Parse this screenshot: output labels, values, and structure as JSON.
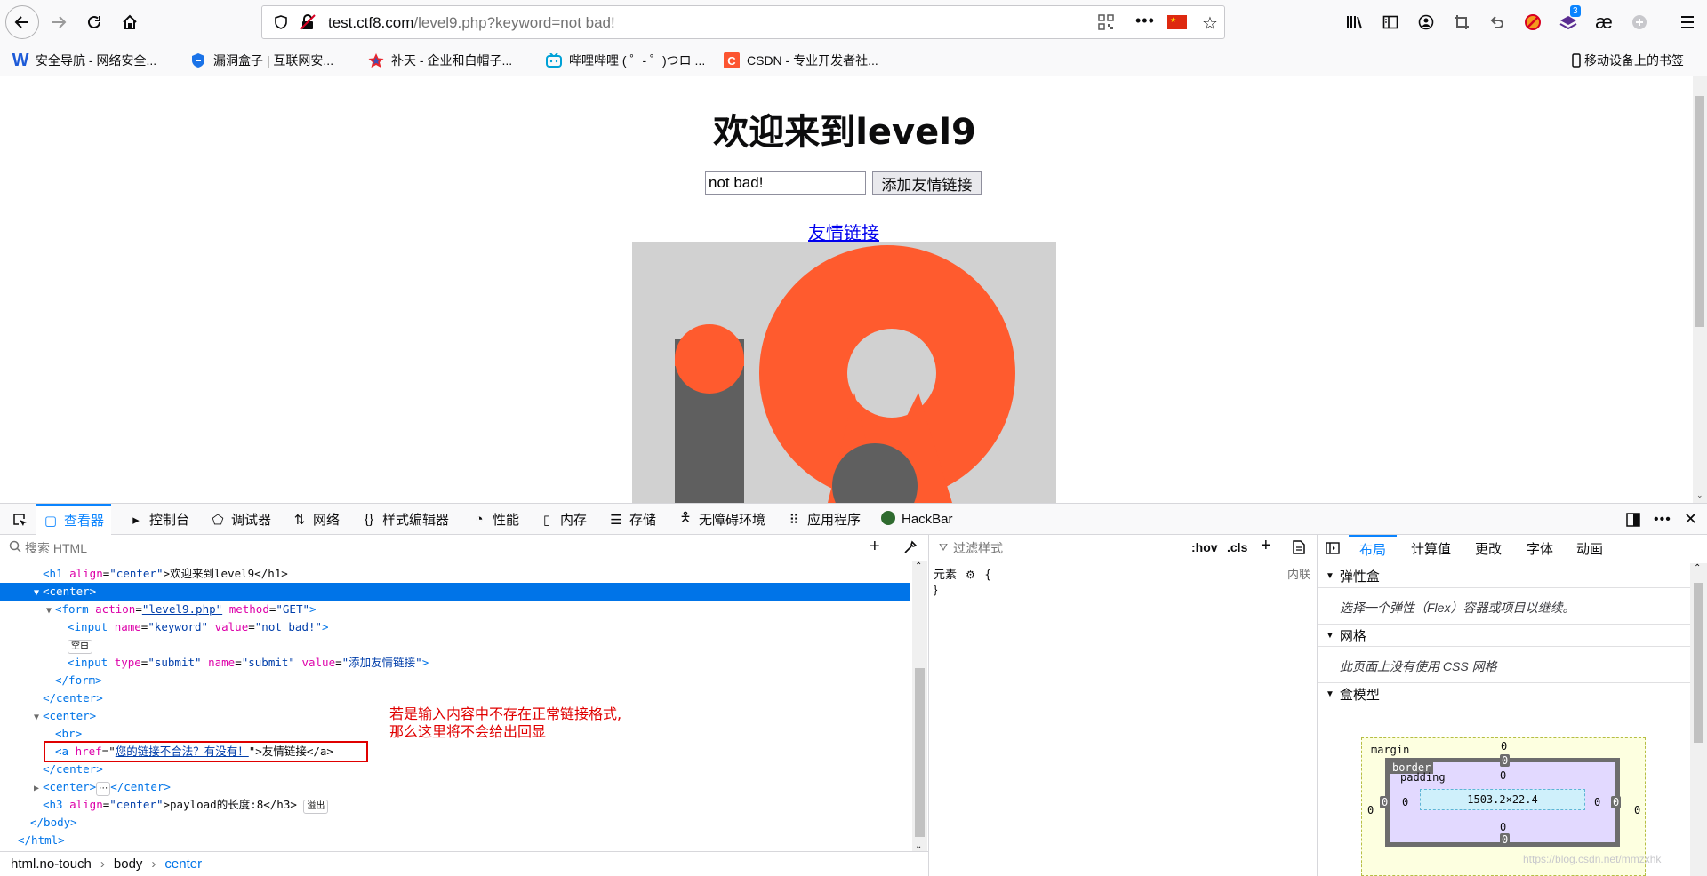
{
  "browser": {
    "url_host": "test.ctf8.com",
    "url_path": "/level9.php?keyword=not bad!",
    "ext_badge": "3",
    "ext_ae": "æ"
  },
  "bookmarks": [
    {
      "icon": "W",
      "label": "安全导航 - 网络安全..."
    },
    {
      "icon": "shield",
      "label": "漏洞盒子 | 互联网安..."
    },
    {
      "icon": "star",
      "label": "补天 - 企业和白帽子..."
    },
    {
      "icon": "tv",
      "label": "哔哩哔哩 ( ゜- ゜)つロ ..."
    },
    {
      "icon": "C",
      "label": "CSDN - 专业开发者社..."
    }
  ],
  "mobile_bookmarks": "移动设备上的书签",
  "page": {
    "heading": "欢迎来到level9",
    "keyword_value": "not bad!",
    "submit_label": "添加友情链接",
    "link_text": "友情链接"
  },
  "devtools": {
    "tabs": [
      "查看器",
      "控制台",
      "调试器",
      "网络",
      "样式编辑器",
      "性能",
      "内存",
      "存储",
      "无障碍环境",
      "应用程序",
      "HackBar"
    ],
    "search_placeholder": "搜索 HTML",
    "code": {
      "l1_open": "<h1 ",
      "l1_attr": "align",
      "l1_val": "\"center\"",
      "l1_rest": ">欢迎来到level9</h1>",
      "l2": "<center>",
      "l3_form": "<form ",
      "l3_a1": "action",
      "l3_v1": "\"level9.php\"",
      "l3_a2": "method",
      "l3_v2": "\"GET\"",
      "l4_input": "<input ",
      "l4_a1": "name",
      "l4_v1": "\"keyword\"",
      "l4_a2": "value",
      "l4_v2": "\"not bad!\"",
      "badge_blank": "空白",
      "l6_a1": "type",
      "l6_v1": "\"submit\"",
      "l6_a2": "name",
      "l6_v2": "\"submit\"",
      "l6_a3": "value",
      "l6_v3": "\"添加友情链接\"",
      "l7": "</form>",
      "l8": "</center>",
      "l9": "<center>",
      "l10": "<br>",
      "l11_open": "<a ",
      "l11_attr": "href",
      "l11_val": "您的链接不合法？有没有！",
      "l11_rest": ">友情链接</a>",
      "l12": "</center>",
      "l13_open": "<center>",
      "l13_close": "</center>",
      "badge_ellipsis": "⋯",
      "l14_open": "<h3 ",
      "l14_attr": "align",
      "l14_val": "\"center\"",
      "l14_rest": ">payload的长度:8</h3>",
      "badge_overflow": "溢出",
      "l15": "</body>",
      "l16": "</html>"
    },
    "annotation_line1": "若是输入内容中不存在正常链接格式,",
    "annotation_line2": "那么这里将不会给出回显",
    "breadcrumb": [
      "html.no-touch",
      "body",
      "center"
    ],
    "rules": {
      "filter_placeholder": "过滤样式",
      "hov": ":hov",
      ".cls": ".cls",
      "element_label": "元素",
      "open_brace": "{",
      "close_brace": "}",
      "inline": "内联"
    },
    "layout": {
      "tabs": [
        "布局",
        "计算值",
        "更改",
        "字体",
        "动画"
      ],
      "flex_title": "弹性盒",
      "flex_msg": "选择一个弹性（Flex）容器或项目以继续。",
      "grid_title": "网格",
      "grid_msg": "此页面上没有使用 CSS 网格",
      "boxmodel_title": "盒模型",
      "margin_label": "margin",
      "border_label": "border",
      "padding_label": "padding",
      "content_size": "1503.2×22.4",
      "zero": "0"
    }
  },
  "watermark": "https://blog.csdn.net/mmzxhk"
}
